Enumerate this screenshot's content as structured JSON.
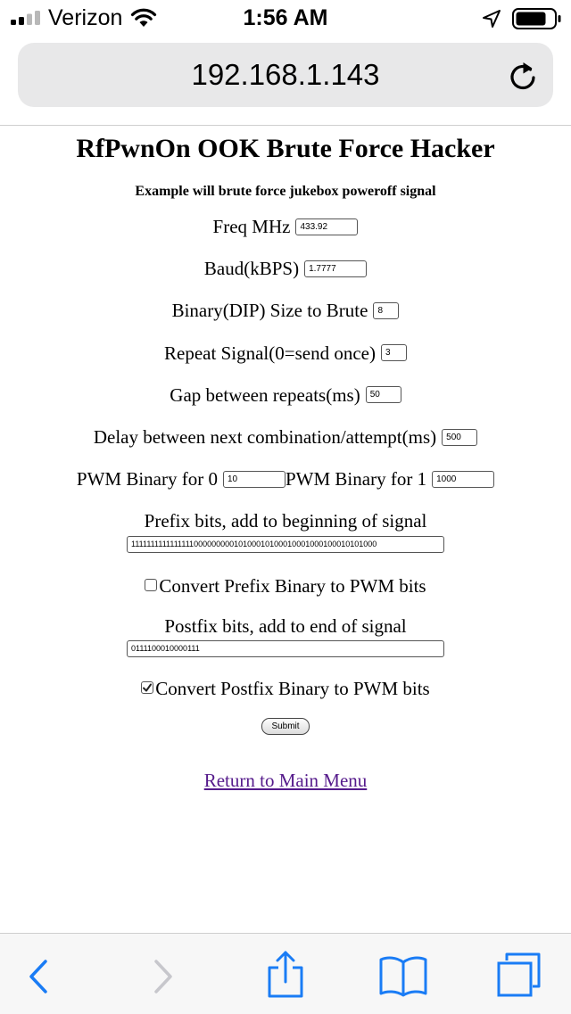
{
  "status_bar": {
    "carrier": "Verizon",
    "time": "1:56 AM"
  },
  "address_bar": {
    "url": "192.168.1.143"
  },
  "page": {
    "title": "RfPwnOn OOK Brute Force Hacker",
    "subtitle": "Example will brute force jukebox poweroff signal",
    "fields": {
      "freq_label": "Freq MHz",
      "freq_value": "433.92",
      "baud_label": "Baud(kBPS)",
      "baud_value": "1.7777",
      "binsize_label": "Binary(DIP) Size to Brute",
      "binsize_value": "8",
      "repeat_label": "Repeat Signal(0=send once)",
      "repeat_value": "3",
      "gap_label": "Gap between repeats(ms)",
      "gap_value": "50",
      "delay_label": "Delay between next combination/attempt(ms)",
      "delay_value": "500",
      "pwm0_label": "PWM Binary for 0",
      "pwm0_value": "10",
      "pwm1_label": "PWM Binary for 1",
      "pwm1_value": "1000",
      "prefix_label": "Prefix bits, add to beginning of signal",
      "prefix_value": "111111111111111100000000010100010100010001000100010101000",
      "convert_prefix_label": "Convert Prefix Binary to PWM bits",
      "convert_prefix_checked": false,
      "postfix_label": "Postfix bits, add to end of signal",
      "postfix_value": "0111100010000111",
      "convert_postfix_label": "Convert Postfix Binary to PWM bits",
      "convert_postfix_checked": true
    },
    "submit_label": "Submit",
    "return_link": "Return to Main Menu"
  },
  "colors": {
    "ios_blue": "#1a7cf5",
    "link_visited": "#551a8b",
    "address_bar_bg": "#e8e8e9",
    "toolbar_bg": "#f7f7f7",
    "disabled_icon": "#c7c7cc"
  },
  "toolbar": {
    "icons": [
      "back-icon",
      "forward-icon",
      "share-icon",
      "bookmarks-icon",
      "tabs-icon"
    ]
  }
}
